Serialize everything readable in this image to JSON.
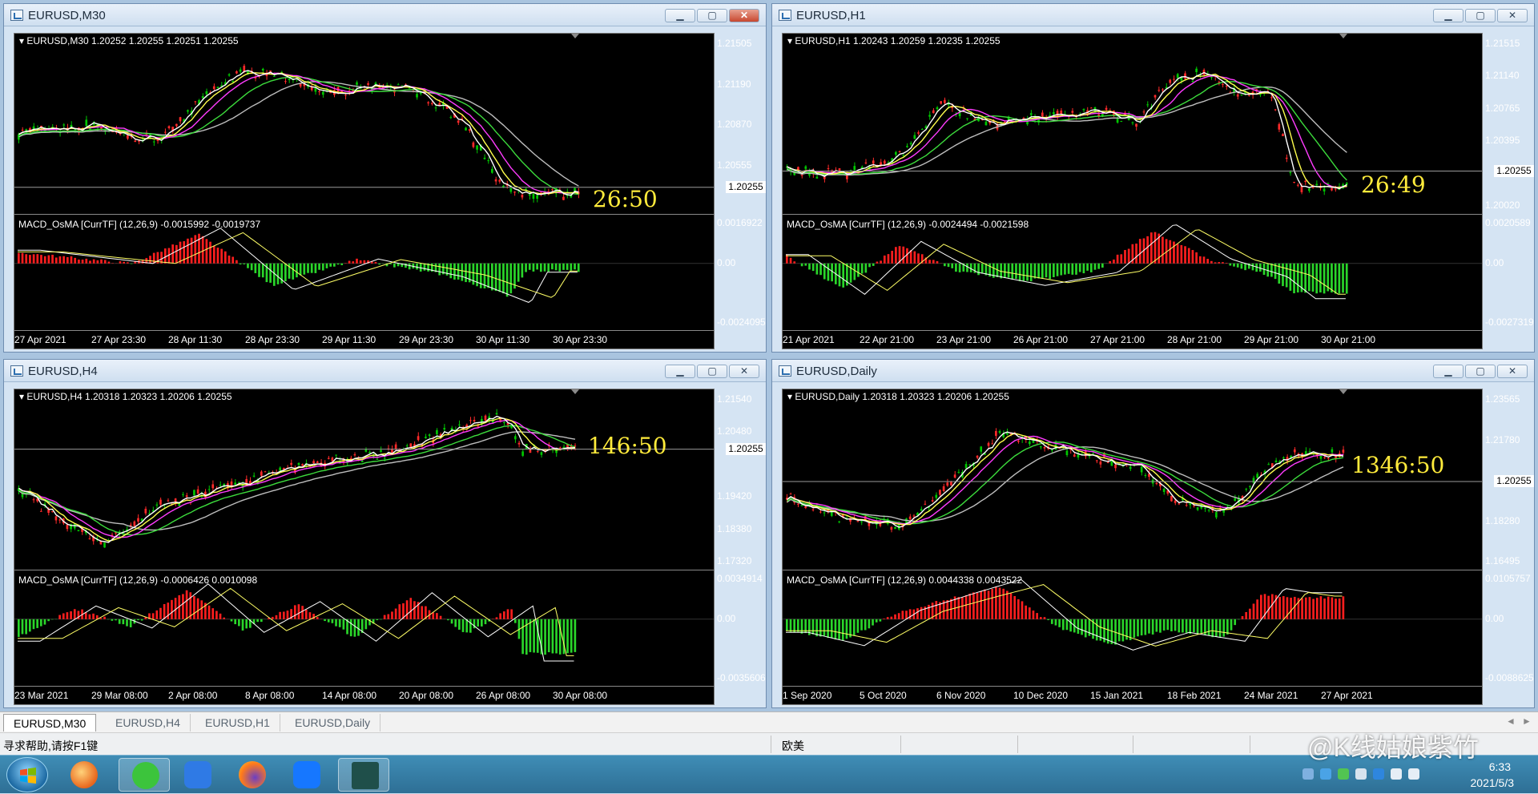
{
  "windows": [
    {
      "id": "m30",
      "title": "EURUSD,M30",
      "active": true,
      "header": "EURUSD,M30  1.20252 1.20255 1.20251 1.20255",
      "price_ticks": [
        "1.21505",
        "1.21190",
        "1.20870",
        "1.20555",
        "1.20255"
      ],
      "current_price": "1.20255",
      "countdown": "26:50",
      "macd_label": "MACD_OsMA [CurrTF] (12,26,9) -0.0015992 -0.0019737",
      "macd_ticks": [
        "0.0016922",
        "0.00",
        "-0.0024095"
      ],
      "time_labels": [
        "27 Apr 2021",
        "27 Apr 23:30",
        "28 Apr 11:30",
        "28 Apr 23:30",
        "29 Apr 11:30",
        "29 Apr 23:30",
        "30 Apr 11:30",
        "30 Apr 23:30"
      ]
    },
    {
      "id": "h1",
      "title": "EURUSD,H1",
      "active": false,
      "header": "EURUSD,H1  1.20243 1.20259 1.20235 1.20255",
      "price_ticks": [
        "1.21515",
        "1.21140",
        "1.20765",
        "1.20395",
        "1.20255",
        "1.20020"
      ],
      "current_price": "1.20255",
      "countdown": "26:49",
      "macd_label": "MACD_OsMA [CurrTF] (12,26,9) -0.0024494 -0.0021598",
      "macd_ticks": [
        "0.0020589",
        "0.00",
        "-0.0027319"
      ],
      "time_labels": [
        "21 Apr 2021",
        "22 Apr 21:00",
        "23 Apr 21:00",
        "26 Apr 21:00",
        "27 Apr 21:00",
        "28 Apr 21:00",
        "29 Apr 21:00",
        "30 Apr 21:00"
      ]
    },
    {
      "id": "h4",
      "title": "EURUSD,H4",
      "active": false,
      "header": "EURUSD,H4  1.20318 1.20323 1.20206 1.20255",
      "price_ticks": [
        "1.21540",
        "1.20480",
        "1.20255",
        "1.19420",
        "1.18380",
        "1.17320"
      ],
      "current_price": "1.20255",
      "countdown": "146:50",
      "macd_label": "MACD_OsMA [CurrTF] (12,26,9) -0.0006426 0.0010098",
      "macd_ticks": [
        "0.0034914",
        "0.00",
        "-0.0035606"
      ],
      "time_labels": [
        "23 Mar 2021",
        "29 Mar 08:00",
        "2 Apr 08:00",
        "8 Apr 08:00",
        "14 Apr 08:00",
        "20 Apr 08:00",
        "26 Apr 08:00",
        "30 Apr 08:00"
      ]
    },
    {
      "id": "d1",
      "title": "EURUSD,Daily",
      "active": false,
      "header": "EURUSD,Daily  1.20318 1.20323 1.20206 1.20255",
      "price_ticks": [
        "1.23565",
        "1.21780",
        "1.20255",
        "1.18280",
        "1.16495"
      ],
      "current_price": "1.20255",
      "countdown": "1346:50",
      "macd_label": "MACD_OsMA [CurrTF] (12,26,9) 0.0044338 0.0043522",
      "macd_ticks": [
        "0.0105757",
        "0.00",
        "-0.0088625"
      ],
      "time_labels": [
        "1 Sep 2020",
        "5 Oct 2020",
        "6 Nov 2020",
        "10 Dec 2020",
        "15 Jan 2021",
        "18 Feb 2021",
        "24 Mar 2021",
        "27 Apr 2021"
      ]
    }
  ],
  "tabs": [
    "EURUSD,M30",
    "EURUSD,H4",
    "EURUSD,H1",
    "EURUSD,Daily"
  ],
  "active_tab": "EURUSD,M30",
  "tab_arrows": {
    "left": "◄",
    "right": "►"
  },
  "status": {
    "help": "寻求帮助,请按F1键",
    "profile": "欧美"
  },
  "taskbar": {
    "clock_time": "6:33",
    "clock_date": "2021/5/3",
    "apps": [
      "browser-app",
      "wechat",
      "feishu-docs",
      "firefox",
      "dingtalk-meeting",
      "stock-app"
    ]
  },
  "watermark": "@K线姑娘紫竹",
  "colors": {
    "bull_candle": "#00c800",
    "bear_candle": "#ff2a2a",
    "ma_white": "#ffffff",
    "ma_yellow": "#ffff4d",
    "ma_magenta": "#ff3cff",
    "ma_green": "#3cdc3c",
    "ma_gray": "#bdbdbd",
    "macd_pos": "#ff1e1e",
    "macd_neg": "#2ad62a",
    "countdown": "#ffeb3b"
  },
  "window_buttons": {
    "minimize": "▁",
    "maximize": "▢",
    "close": "✕"
  }
}
